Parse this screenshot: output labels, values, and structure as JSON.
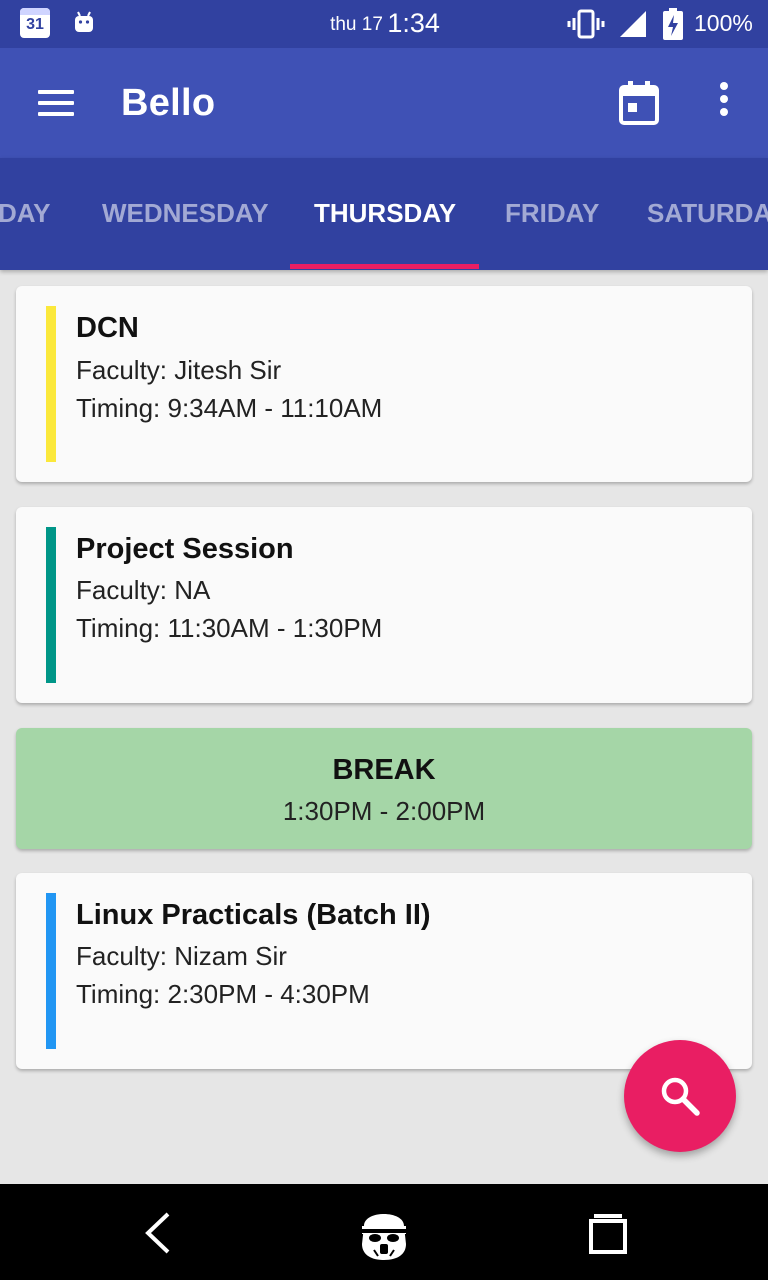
{
  "status_bar": {
    "calendar_day": "31",
    "clock_day": "thu 17",
    "clock_time": "1:34",
    "battery_pct": "100%",
    "icons": [
      "calendar-icon",
      "android-icon",
      "vibrate-icon",
      "signal-icon",
      "battery-charging-icon"
    ]
  },
  "toolbar": {
    "title": "Bello",
    "icons": [
      "menu-icon",
      "calendar-icon",
      "overflow-icon"
    ]
  },
  "tabs": {
    "items": [
      {
        "label": "SUNDAY",
        "visible_text": "DAY"
      },
      {
        "label": "WEDNESDAY"
      },
      {
        "label": "THURSDAY"
      },
      {
        "label": "FRIDAY"
      },
      {
        "label": "SATURDAY"
      }
    ],
    "selected": "THURSDAY",
    "indicator_color": "#e91e63"
  },
  "schedule": [
    {
      "subject": "DCN",
      "faculty": "Faculty: Jitesh Sir",
      "timing": "Timing: 9:34AM - 11:10AM",
      "accent": "#fbe83b"
    },
    {
      "subject": "Project Session",
      "faculty": "Faculty: NA",
      "timing": "Timing: 11:30AM - 1:30PM",
      "accent": "#009688"
    },
    {
      "subject": "Linux Practicals (Batch II)",
      "faculty": "Faculty: Nizam Sir",
      "timing": "Timing: 2:30PM - 4:30PM",
      "accent": "#2196f3"
    }
  ],
  "break": {
    "title": "BREAK",
    "time": "1:30PM - 2:00PM",
    "color": "#a5d6a7"
  },
  "fab": {
    "icon": "search-icon",
    "color": "#e91e63"
  },
  "nav_bar": {
    "icons": [
      "back-icon",
      "home-icon",
      "recents-icon"
    ]
  },
  "colors": {
    "primary": "#3f51b5",
    "primary_dark": "#3141a0",
    "accent": "#e91e63",
    "background": "#e6e6e6"
  }
}
